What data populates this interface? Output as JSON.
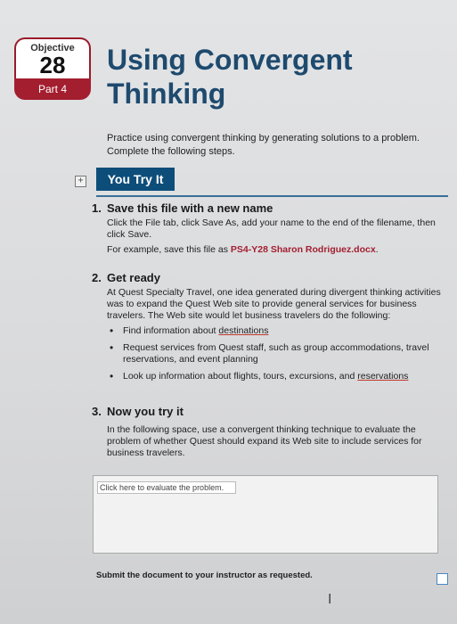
{
  "badge": {
    "label": "Objective",
    "number": "28",
    "part": "Part 4"
  },
  "title": {
    "line1": "Using Convergent",
    "line2": "Thinking"
  },
  "intro": "Practice using convergent thinking by generating solutions to a problem. Complete the following steps.",
  "section": {
    "label": "You Try It"
  },
  "steps": [
    {
      "num": "1.",
      "title": "Save this file with a new name",
      "text": "Click the File tab, click Save As, add your name to the end of the filename, then click Save.",
      "example_prefix": "For example, save this file as ",
      "example_file": "PS4-Y28 Sharon Rodriguez.docx",
      "example_suffix": "."
    },
    {
      "num": "2.",
      "title": "Get ready",
      "text": "At Quest Specialty Travel, one idea generated during divergent thinking activities was to expand the Quest Web site to provide general services for business travelers. The Web site would let business travelers do the following:",
      "bullets": [
        {
          "pre": "Find information about ",
          "link": "destinations",
          "post": ""
        },
        {
          "pre": "Request services from Quest staff, such as group accommodations, travel reservations, and event planning",
          "link": "",
          "post": ""
        },
        {
          "pre": "Look up information about flights, tours, excursions, and ",
          "link": "reservations",
          "post": ""
        }
      ]
    },
    {
      "num": "3.",
      "title": "Now you try it",
      "text": "In the following space, use a convergent thinking technique to evaluate the problem of whether Quest should expand its Web site to include services for business travelers."
    }
  ],
  "answer": {
    "placeholder": "Click here to evaluate the problem."
  },
  "submit": "Submit the document to your instructor as requested.",
  "colors": {
    "brand_red": "#a31e2f",
    "title_blue": "#1e4a6e",
    "section_blue": "#0d4d7a"
  },
  "icons": {
    "expand": "expand-icon",
    "checkbox": "checkbox-icon",
    "cursor": "text-cursor-icon"
  }
}
